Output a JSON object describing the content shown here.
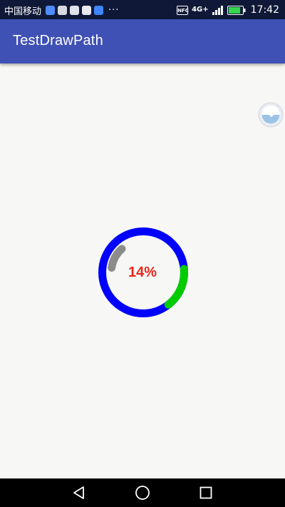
{
  "status_bar": {
    "carrier": "中国移动",
    "more": "···",
    "nfc": "NFC",
    "network": "4G+",
    "time": "17:42",
    "battery_level": 0.85
  },
  "app_bar": {
    "title": "TestDrawPath"
  },
  "progress_view": {
    "text": "14%",
    "track_color": "#0000ff",
    "arc_green_color": "#00cc00",
    "arc_gray_color": "#8c8c8c",
    "text_color": "#e8261a"
  },
  "nav_bar": {
    "back_icon": "back-triangle-icon",
    "home_icon": "home-circle-icon",
    "recent_icon": "recent-square-icon"
  }
}
